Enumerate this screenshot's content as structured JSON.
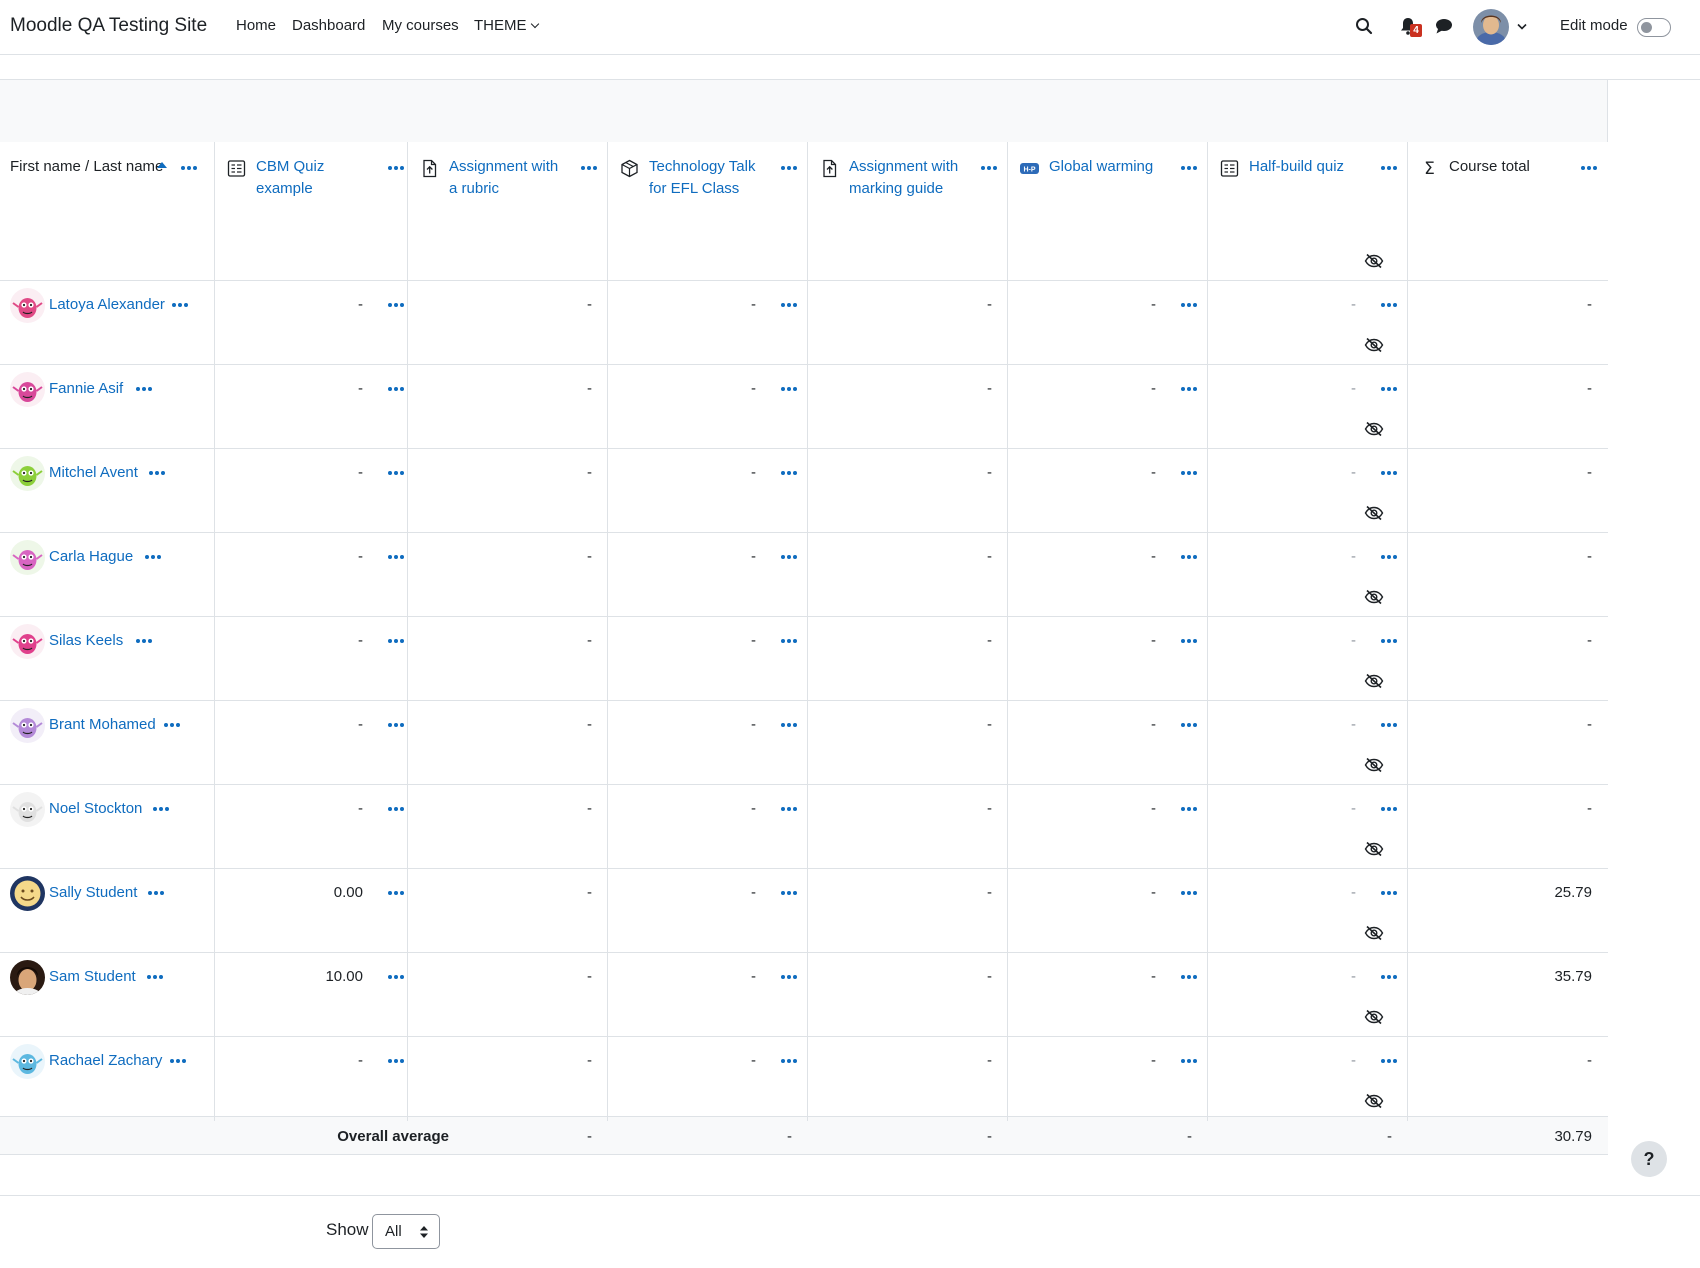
{
  "navbar": {
    "site_name": "Moodle QA Testing Site",
    "links": [
      "Home",
      "Dashboard",
      "My courses",
      "THEME"
    ],
    "notification_count": "4",
    "edit_mode_label": "Edit mode",
    "edit_mode_on": false
  },
  "grader": {
    "name_header": "First name / Last name",
    "items": [
      {
        "label": "CBM Quiz example",
        "icon": "quiz-icon"
      },
      {
        "label": "Assignment with a rubric",
        "icon": "assignment-icon"
      },
      {
        "label": "Technology Talk for EFL Class",
        "icon": "package-icon"
      },
      {
        "label": "Assignment with marking guide",
        "icon": "assignment-icon"
      },
      {
        "label": "Global warming",
        "icon": "h5p-icon",
        "icon_text": "H-P"
      },
      {
        "label": "Half-build quiz",
        "icon": "quiz-icon",
        "hidden": true
      },
      {
        "label": "Course total",
        "icon": "sigma-icon",
        "symbol": "Σ"
      }
    ],
    "rows": [
      {
        "name": "Latoya Alexander",
        "grades": [
          "-",
          "-",
          "-",
          "-",
          "-",
          "-",
          "-"
        ]
      },
      {
        "name": "Fannie Asif",
        "grades": [
          "-",
          "-",
          "-",
          "-",
          "-",
          "-",
          "-"
        ]
      },
      {
        "name": "Mitchel Avent",
        "grades": [
          "-",
          "-",
          "-",
          "-",
          "-",
          "-",
          "-"
        ]
      },
      {
        "name": "Carla Hague",
        "grades": [
          "-",
          "-",
          "-",
          "-",
          "-",
          "-",
          "-"
        ]
      },
      {
        "name": "Silas Keels",
        "grades": [
          "-",
          "-",
          "-",
          "-",
          "-",
          "-",
          "-"
        ]
      },
      {
        "name": "Brant Mohamed",
        "grades": [
          "-",
          "-",
          "-",
          "-",
          "-",
          "-",
          "-"
        ]
      },
      {
        "name": "Noel Stockton",
        "grades": [
          "-",
          "-",
          "-",
          "-",
          "-",
          "-",
          "-"
        ]
      },
      {
        "name": "Sally Student",
        "grades": [
          "0.00",
          "-",
          "-",
          "-",
          "-",
          "-",
          "25.79"
        ]
      },
      {
        "name": "Sam Student",
        "grades": [
          "10.00",
          "-",
          "-",
          "-",
          "-",
          "-",
          "35.79"
        ]
      },
      {
        "name": "Rachael Zachary",
        "grades": [
          "-",
          "-",
          "-",
          "-",
          "-",
          "-",
          "-"
        ]
      }
    ],
    "overall_average_label": "Overall average",
    "overall_average": [
      "-",
      "-",
      "-",
      "-",
      "-",
      "30.79"
    ]
  },
  "pagination": {
    "show_label": "Show",
    "selected": "All"
  },
  "help_label": "?",
  "colors": {
    "link": "#0f6cbf",
    "text": "#1d2125",
    "border": "#dee2e6",
    "muted": "#8f959e",
    "badge": "#ca3120",
    "band": "#f8f9fa"
  }
}
